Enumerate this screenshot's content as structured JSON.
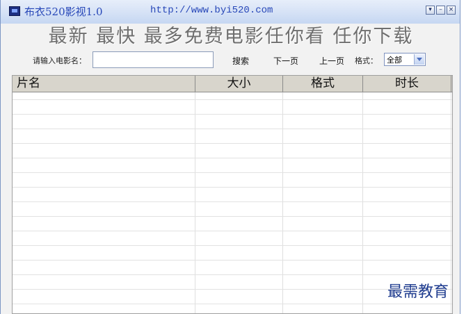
{
  "window": {
    "title": "布衣520影视1.0",
    "url": "http://www.byi520.com",
    "controls": {
      "dropdown_glyph": "▾",
      "minimize_glyph": "–",
      "close_glyph": "×"
    }
  },
  "banner": {
    "slogan": "最新 最快 最多免费电影任你看 任你下载"
  },
  "search": {
    "label": "请输入电影名：",
    "value": "",
    "search_button": "搜索",
    "next_button": "下一页",
    "prev_button": "上一页",
    "format_label": "格式：",
    "format_selected": "全部"
  },
  "table": {
    "columns": [
      "片名",
      "大小",
      "格式",
      "时长"
    ],
    "rows": []
  },
  "watermark": "最需教育",
  "colors": {
    "title_text": "#2747b8",
    "slogan_text": "#6f6f6f",
    "watermark_text": "#1f3c8f"
  }
}
